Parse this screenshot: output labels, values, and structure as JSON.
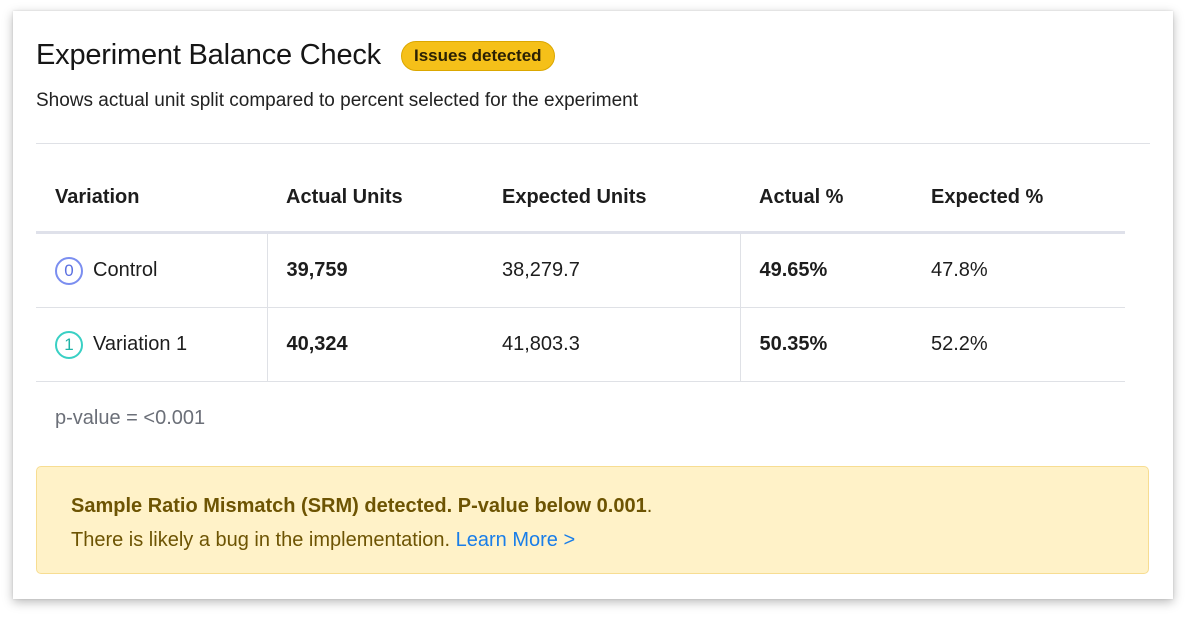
{
  "header": {
    "title": "Experiment Balance Check",
    "badge": "Issues detected",
    "subtitle": "Shows actual unit split compared to percent selected for the experiment"
  },
  "table": {
    "columns": [
      "Variation",
      "Actual Units",
      "Expected Units",
      "Actual %",
      "Expected %"
    ],
    "rows": [
      {
        "index": "0",
        "name": "Control",
        "actual_units": "39,759",
        "expected_units": "38,279.7",
        "actual_pct": "49.65%",
        "expected_pct": "47.8%",
        "color": "#7b8ef0"
      },
      {
        "index": "1",
        "name": "Variation 1",
        "actual_units": "40,324",
        "expected_units": "41,803.3",
        "actual_pct": "50.35%",
        "expected_pct": "52.2%",
        "color": "#39d0c4"
      }
    ]
  },
  "pvalue": "p-value = <0.001",
  "alert": {
    "headline": "Sample Ratio Mismatch (SRM) detected. P-value below 0.001",
    "period": ".",
    "body": "There is likely a bug in the implementation.",
    "link": "Learn More >"
  },
  "colors": {
    "badge": "#f5c019",
    "alert_bg": "#fff2c8",
    "alert_text": "#6d5403",
    "link": "#1a7ee8"
  }
}
